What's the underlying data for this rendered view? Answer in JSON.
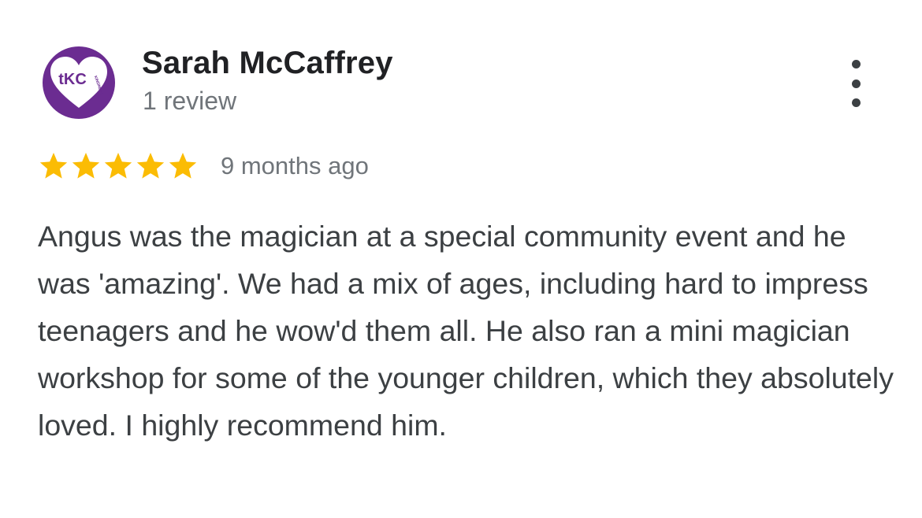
{
  "reviewer": {
    "name": "Sarah McCaffrey",
    "review_count": "1 review",
    "avatar": {
      "initials": "tKC",
      "subtext": "KINDNESS",
      "icon": "heart-logo-icon",
      "bg_color": "#6b2c91"
    }
  },
  "menu": {
    "icon": "more-vert-icon"
  },
  "rating": {
    "stars": 5,
    "max_stars": 5,
    "star_color": "#fbbc04",
    "time": "9 months ago"
  },
  "review": {
    "text": "Angus was the magician at a special community event and he was 'amazing'. We had a mix of ages, including hard to impress teenagers and he wow'd them all. He also ran a mini magician workshop for some of the younger children, which they absolutely loved. I highly recommend him."
  }
}
